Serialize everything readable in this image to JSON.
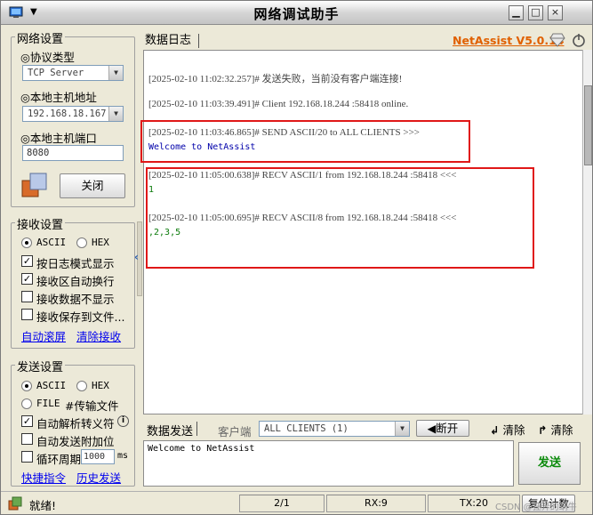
{
  "window": {
    "title": "网络调试助手",
    "menu_glyph": "▼"
  },
  "net_settings": {
    "group_label": "网络设置",
    "protocol_label": "◎协议类型",
    "protocol_value": "TCP Server",
    "host_label": "◎本地主机地址",
    "host_value": "192.168.18.167",
    "port_label": "◎本地主机端口",
    "port_value": "8080",
    "close_button": "关闭"
  },
  "recv_settings": {
    "group_label": "接收设置",
    "ascii": "ASCII",
    "hex": "HEX",
    "options": [
      "按日志模式显示",
      "接收区自动换行",
      "接收数据不显示",
      "接收保存到文件..."
    ],
    "checked": [
      true,
      true,
      false,
      false
    ],
    "auto_scroll": "自动滚屏",
    "clear_recv": "清除接收"
  },
  "send_settings": {
    "group_label": "发送设置",
    "ascii": "ASCII",
    "hex": "HEX",
    "file": "FILE",
    "file_transfer": "#传输文件",
    "auto_escape": "自动解析转义符",
    "append": "自动发送附加位",
    "loop": "循环周期",
    "loop_value": "1000",
    "loop_unit": "ms",
    "shortcut": "快捷指令",
    "history": "历史发送"
  },
  "log": {
    "tab": "数据日志",
    "brand": "NetAssist V5.0.14",
    "entries": [
      {
        "header": "[2025-02-10 11:02:32.257]# 发送失败，当前没有客户端连接!",
        "body": ""
      },
      {
        "header": "[2025-02-10 11:03:39.491]# Client 192.168.18.244 :58418 online.",
        "body": ""
      },
      {
        "header": "[2025-02-10 11:03:46.865]# SEND ASCII/20 to ALL CLIENTS >>>",
        "body": "Welcome to NetAssist"
      },
      {
        "header": "[2025-02-10 11:05:00.638]# RECV ASCII/1 from 192.168.18.244 :58418 <<<",
        "body": "1"
      },
      {
        "header": "[2025-02-10 11:05:00.695]# RECV ASCII/8 from 192.168.18.244 :58418 <<<",
        "body": ",2,3,5"
      }
    ]
  },
  "send_area": {
    "tab": "数据发送",
    "client_label": "客户端",
    "client_value": "ALL CLIENTS (1)",
    "disconnect": "断开",
    "clear1": "清除",
    "clear2": "清除",
    "content": "Welcome to NetAssist",
    "send_button": "发送"
  },
  "status": {
    "state": "就绪!",
    "page": "2/1",
    "rx": "RX:9",
    "tx": "TX:20",
    "reset": "复位计数",
    "watermark": "CSDN @狂奔的蜗牛"
  },
  "colors": {
    "accent_red": "#e01818",
    "send_green": "#0a8a0a",
    "brand_orange": "#e06000",
    "log_blue": "#0000aa"
  }
}
